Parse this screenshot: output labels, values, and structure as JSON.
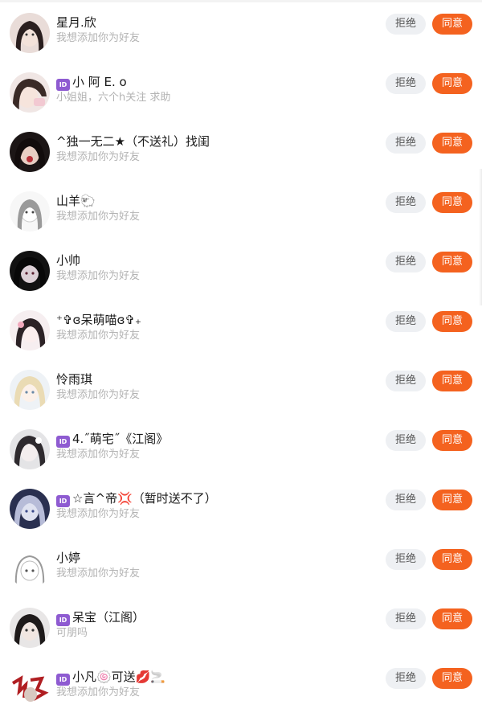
{
  "requests": [
    {
      "name": "星月.欣",
      "has_id_badge": false,
      "message": "我想添加你为好友",
      "reject_label": "拒绝",
      "accept_label": "同意"
    },
    {
      "name": "小 阿 E. o",
      "has_id_badge": true,
      "message": "小姐姐，六个h关注 求助",
      "reject_label": "拒绝",
      "accept_label": "同意"
    },
    {
      "name": "^独一无二★（不送礼）找闺",
      "has_id_badge": false,
      "message": "我想添加你为好友",
      "reject_label": "拒绝",
      "accept_label": "同意"
    },
    {
      "name": "山羊🐑",
      "has_id_badge": false,
      "message": "我想添加你为好友",
      "reject_label": "拒绝",
      "accept_label": "同意"
    },
    {
      "name": "小帅",
      "has_id_badge": false,
      "message": "我想添加你为好友",
      "reject_label": "拒绝",
      "accept_label": "同意"
    },
    {
      "name": "⁺✞ɞ呆萌喵ɞ✞₊",
      "has_id_badge": false,
      "message": "我想添加你为好友",
      "reject_label": "拒绝",
      "accept_label": "同意"
    },
    {
      "name": "怜雨琪",
      "has_id_badge": false,
      "message": "我想添加你为好友",
      "reject_label": "拒绝",
      "accept_label": "同意"
    },
    {
      "name": "4.˝萌宅˝《江阁》",
      "has_id_badge": true,
      "message": "我想添加你为好友",
      "reject_label": "拒绝",
      "accept_label": "同意"
    },
    {
      "name": "☆言^帝💢（暂时送不了）",
      "has_id_badge": true,
      "message": "我想添加你为好友",
      "reject_label": "拒绝",
      "accept_label": "同意"
    },
    {
      "name": "小婷",
      "has_id_badge": false,
      "message": "我想添加你为好友",
      "reject_label": "拒绝",
      "accept_label": "同意"
    },
    {
      "name": "呆宝（江阁）",
      "has_id_badge": true,
      "message": "可朋吗",
      "reject_label": "拒绝",
      "accept_label": "同意"
    },
    {
      "name": "小凡🍥可送💋🚬",
      "has_id_badge": true,
      "message": "我想添加你为好友",
      "reject_label": "拒绝",
      "accept_label": "同意"
    }
  ],
  "id_badge_text": "ID",
  "colors": {
    "accept": "#f4621f",
    "reject_bg": "#eef0f3",
    "id_badge": "#8e5bd1",
    "name_text": "#1a1a1a",
    "message_text": "#b3b3b3"
  }
}
